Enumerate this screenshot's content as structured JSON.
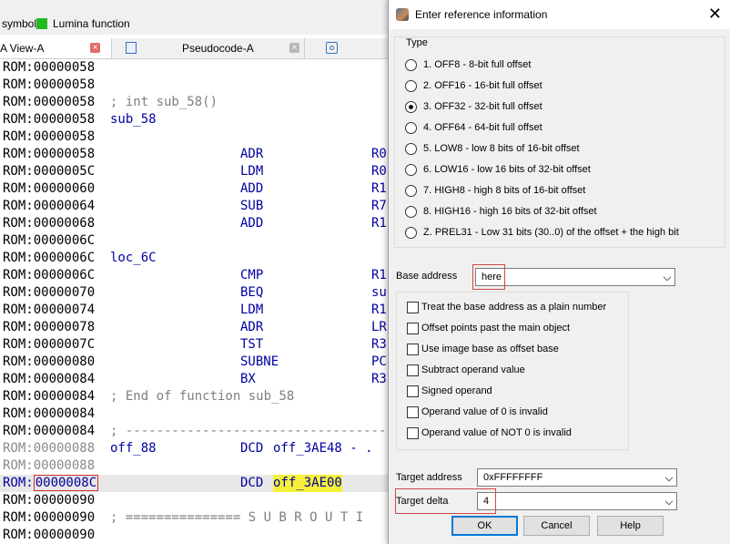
{
  "legend": {
    "symbol": "symbol",
    "lumina": "Lumina function",
    "lumina_color": "#22bb22"
  },
  "tabs": {
    "ida_view": "A View-A",
    "pseudocode": "Pseudocode-A",
    "close_glyph": "×"
  },
  "listing": [
    {
      "addr": "ROM:00000058"
    },
    {
      "addr": "ROM:00000058"
    },
    {
      "addr": "ROM:00000058",
      "cmt": "; int sub_58()"
    },
    {
      "addr": "ROM:00000058",
      "label": "sub_58"
    },
    {
      "addr": "ROM:00000058"
    },
    {
      "addr": "ROM:00000058",
      "mn": "ADR",
      "op": "R0"
    },
    {
      "addr": "ROM:0000005C",
      "mn": "LDM",
      "op": "R0"
    },
    {
      "addr": "ROM:00000060",
      "mn": "ADD",
      "op": "R1"
    },
    {
      "addr": "ROM:00000064",
      "mn": "SUB",
      "op": "R7"
    },
    {
      "addr": "ROM:00000068",
      "mn": "ADD",
      "op": "R1"
    },
    {
      "addr": "ROM:0000006C"
    },
    {
      "addr": "ROM:0000006C",
      "label": "loc_6C"
    },
    {
      "addr": "ROM:0000006C",
      "mn": "CMP",
      "op": "R1"
    },
    {
      "addr": "ROM:00000070",
      "mn": "BEQ",
      "op": "su"
    },
    {
      "addr": "ROM:00000074",
      "mn": "LDM",
      "op": "R1"
    },
    {
      "addr": "ROM:00000078",
      "mn": "ADR",
      "op": "LR"
    },
    {
      "addr": "ROM:0000007C",
      "mn": "TST",
      "op": "R3"
    },
    {
      "addr": "ROM:00000080",
      "mn": "SUBNE",
      "op": "PC"
    },
    {
      "addr": "ROM:00000084",
      "mn": "BX",
      "op": "R3"
    },
    {
      "addr": "ROM:00000084",
      "cmt": "; End of function sub_58"
    },
    {
      "addr": "ROM:00000084"
    },
    {
      "addr": "ROM:00000084",
      "cmt": "; ---------------------------------------------"
    },
    {
      "addr": "ROM:00000088",
      "gray": true,
      "label": "off_88",
      "mn": "DCD",
      "op2": "off_3AE48 - ."
    },
    {
      "addr": "ROM:00000088",
      "gray": true
    },
    {
      "addr_seg": "ROM:",
      "addr_off": "0000008C",
      "selected": true,
      "mn": "DCD",
      "op2_hl": "off_3AE00"
    },
    {
      "addr": "ROM:00000090"
    },
    {
      "addr": "ROM:00000090",
      "cmt": "; =============== S U B R O U T I"
    },
    {
      "addr": "ROM:00000090"
    }
  ],
  "dialog": {
    "title": "Enter reference information",
    "close_glyph": "✕",
    "type_label": "Type",
    "radios": [
      {
        "key": "1",
        "text": "1. OFF8 - 8-bit full offset",
        "checked": false
      },
      {
        "key": "2",
        "text": "2. OFF16 - 16-bit full offset",
        "checked": false
      },
      {
        "key": "3",
        "text": "3. OFF32 - 32-bit full offset",
        "checked": true
      },
      {
        "key": "4",
        "text": "4. OFF64 - 64-bit full offset",
        "checked": false
      },
      {
        "key": "5",
        "text": "5. LOW8 - low 8 bits of 16-bit offset",
        "checked": false
      },
      {
        "key": "6",
        "text": "6. LOW16 - low 16 bits of 32-bit offset",
        "checked": false
      },
      {
        "key": "7",
        "text": "7. HIGH8 - high 8 bits of 16-bit offset",
        "checked": false
      },
      {
        "key": "8",
        "text": "8. HIGH16 - high 16 bits of 32-bit offset",
        "checked": false
      },
      {
        "key": "Z",
        "text": "Z. PREL31 - Low 31 bits (30..0) of the offset + the high bit",
        "checked": false
      }
    ],
    "base_address": {
      "label": "Base address",
      "value": "here"
    },
    "checkboxes": [
      {
        "text": "Treat the base address as a plain number",
        "checked": false
      },
      {
        "text": "Offset points past the main object",
        "checked": false
      },
      {
        "text": "Use image base as offset base",
        "checked": false
      },
      {
        "text": "Subtract operand value",
        "checked": false
      },
      {
        "text": "Signed operand",
        "checked": false
      },
      {
        "text": "Operand value of 0 is invalid",
        "checked": false
      },
      {
        "text": "Operand value of NOT 0 is invalid",
        "checked": false
      }
    ],
    "target_address": {
      "label": "Target address",
      "value": "0xFFFFFFFF"
    },
    "target_delta": {
      "label": "Target delta",
      "value": "4"
    },
    "buttons": {
      "ok": "OK",
      "cancel": "Cancel",
      "help": "Help"
    }
  }
}
